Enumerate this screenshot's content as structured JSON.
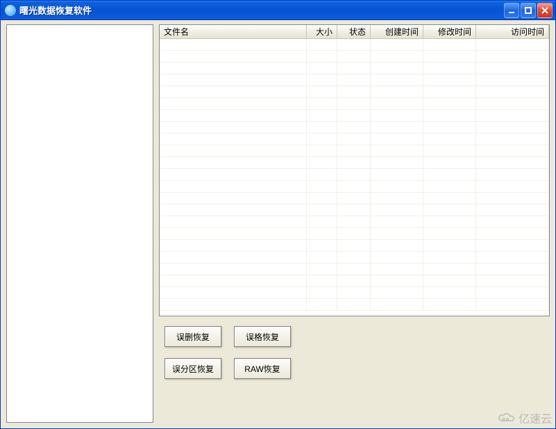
{
  "window": {
    "title": "曙光数据恢复软件"
  },
  "sidebar": {
    "items": []
  },
  "list": {
    "columns": {
      "name": "文件名",
      "size": "大小",
      "status": "状态",
      "ctime": "创建时间",
      "mtime": "修改时间",
      "atime": "访问时间"
    },
    "rows": []
  },
  "actions": {
    "recover_deleted": "误删恢复",
    "recover_formatted": "误格恢复",
    "recover_partition": "误分区恢复",
    "recover_raw": "RAW恢复"
  },
  "watermark": {
    "text": "亿速云"
  }
}
